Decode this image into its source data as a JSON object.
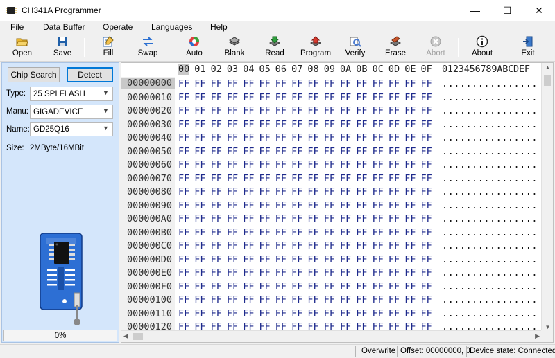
{
  "window": {
    "title": "CH341A Programmer",
    "minimize": "—",
    "maximize": "☐",
    "close": "✕"
  },
  "menu": [
    "File",
    "Data Buffer",
    "Operate",
    "Languages",
    "Help"
  ],
  "toolbar": {
    "buttons": [
      {
        "label": "Open",
        "icon": "open-folder-icon"
      },
      {
        "label": "Save",
        "icon": "save-disk-icon"
      },
      {
        "label": "Fill",
        "icon": "fill-icon"
      },
      {
        "label": "Swap",
        "icon": "swap-arrows-icon"
      },
      {
        "label": "Auto",
        "icon": "auto-icon"
      },
      {
        "label": "Blank",
        "icon": "blank-chip-icon"
      },
      {
        "label": "Read",
        "icon": "read-chip-icon"
      },
      {
        "label": "Program",
        "icon": "program-chip-icon"
      },
      {
        "label": "Verify",
        "icon": "verify-icon"
      },
      {
        "label": "Erase",
        "icon": "erase-icon"
      },
      {
        "label": "Abort",
        "icon": "abort-icon",
        "disabled": true
      },
      {
        "label": "About",
        "icon": "info-icon"
      },
      {
        "label": "Exit",
        "icon": "exit-door-icon"
      }
    ]
  },
  "left_panel": {
    "chip_search_label": "Chip Search",
    "detect_label": "Detect",
    "type_label": "Type:",
    "type_value": "25 SPI FLASH",
    "manu_label": "Manu:",
    "manu_value": "GIGADEVICE",
    "name_label": "Name:",
    "name_value": "GD25Q16",
    "size_label": "Size:",
    "size_value": "2MByte/16MBit",
    "progress_text": "0%",
    "progress_value": 0
  },
  "hex": {
    "header_cols": [
      "00",
      "01",
      "02",
      "03",
      "04",
      "05",
      "06",
      "07",
      "08",
      "09",
      "0A",
      "0B",
      "0C",
      "0D",
      "0E",
      "0F"
    ],
    "ascii_header": "0123456789ABCDEF",
    "cell_value": "FF",
    "ascii_row": "................",
    "rows": [
      "00000000",
      "00000010",
      "00000020",
      "00000030",
      "00000040",
      "00000050",
      "00000060",
      "00000070",
      "00000080",
      "00000090",
      "000000A0",
      "000000B0",
      "000000C0",
      "000000D0",
      "000000E0",
      "000000F0",
      "00000100",
      "00000110",
      "00000120"
    ]
  },
  "status": {
    "mode": "Overwrite",
    "offset": "Offset: 00000000, 0",
    "device_state": "Device state: Connected."
  }
}
